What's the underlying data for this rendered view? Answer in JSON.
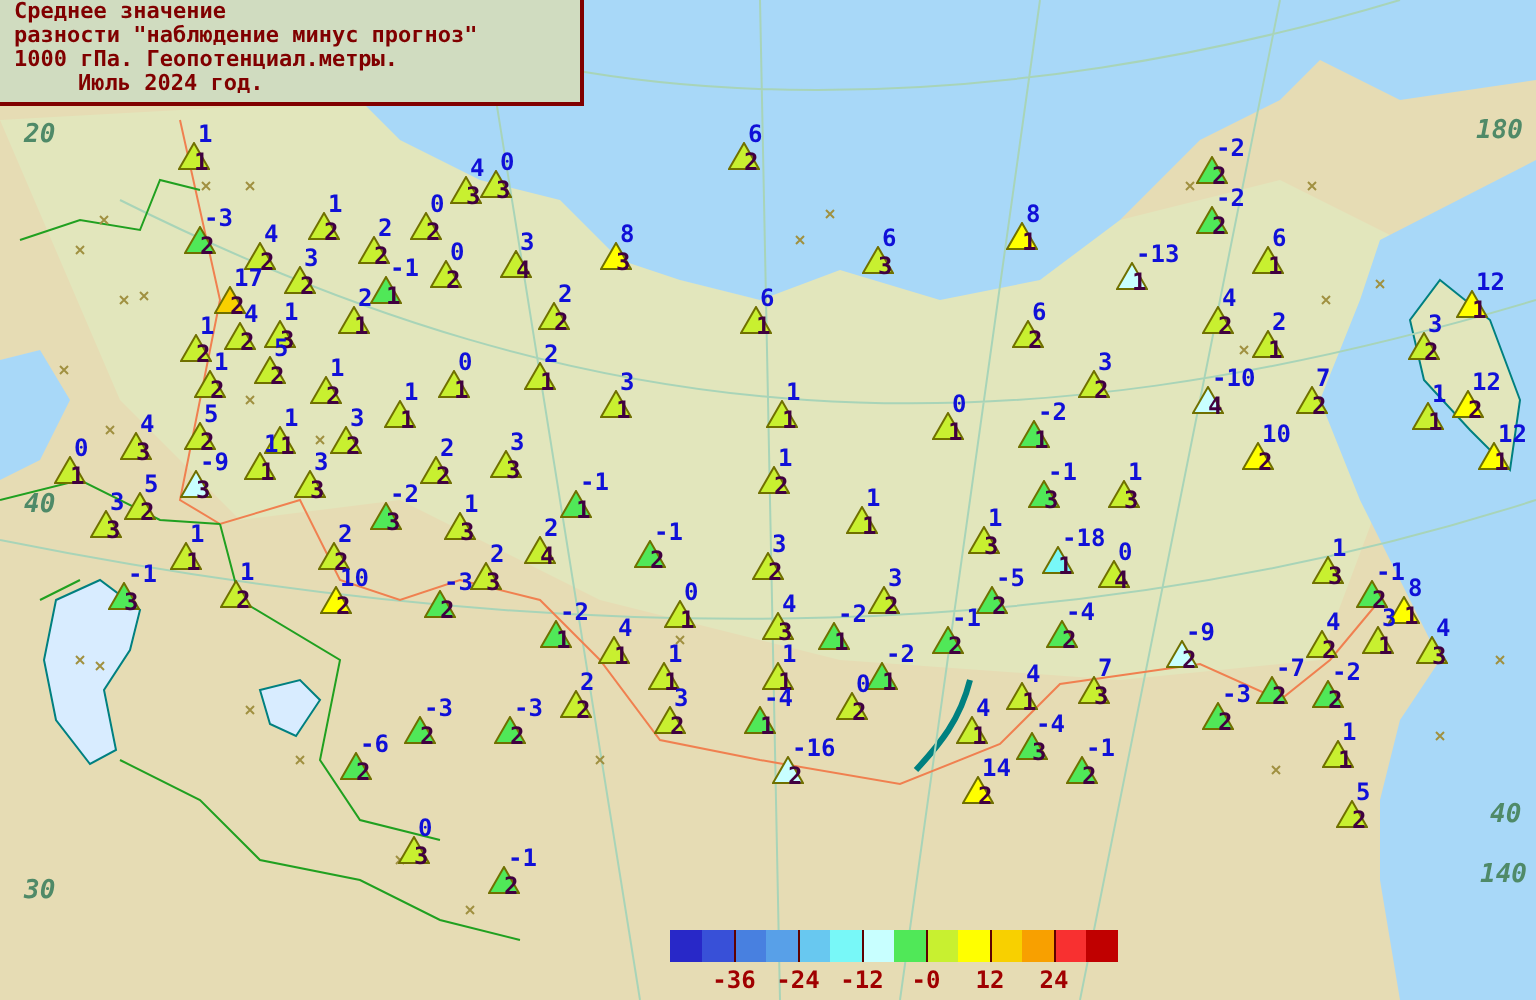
{
  "title": {
    "lines": [
      "Среднее значение",
      "разности \"наблюдение минус прогноз\"",
      "1000 гПа. Геопотенциал.метры."
    ],
    "period": "Июль 2024 год."
  },
  "grid_labels": [
    "20",
    "180",
    "40",
    "40",
    "140",
    "30"
  ],
  "stations": [
    {
      "value": "1",
      "count": "1"
    },
    {
      "value": "6",
      "count": "2"
    },
    {
      "value": "-2",
      "count": "2"
    },
    {
      "value": "4",
      "count": "3"
    },
    {
      "value": "0",
      "count": "3"
    },
    {
      "value": "1",
      "count": "2"
    },
    {
      "value": "0",
      "count": "2"
    },
    {
      "value": "-2",
      "count": "2"
    },
    {
      "value": "-3",
      "count": "2"
    },
    {
      "value": "4",
      "count": "2"
    },
    {
      "value": "2",
      "count": "2"
    },
    {
      "value": "3",
      "count": "4"
    },
    {
      "value": "8",
      "count": "3"
    },
    {
      "value": "6",
      "count": "3"
    },
    {
      "value": "8",
      "count": "1"
    },
    {
      "value": "6",
      "count": "1"
    },
    {
      "value": "3",
      "count": "2"
    },
    {
      "value": "-1",
      "count": "1"
    },
    {
      "value": "0",
      "count": "2"
    },
    {
      "value": "-13",
      "count": "1"
    },
    {
      "value": "17",
      "count": "2"
    },
    {
      "value": "2",
      "count": "1"
    },
    {
      "value": "2",
      "count": "2"
    },
    {
      "value": "6",
      "count": "1"
    },
    {
      "value": "4",
      "count": "2"
    },
    {
      "value": "12",
      "count": "1"
    },
    {
      "value": "1",
      "count": "2"
    },
    {
      "value": "4",
      "count": "2"
    },
    {
      "value": "1",
      "count": "3"
    },
    {
      "value": "6",
      "count": "2"
    },
    {
      "value": "2",
      "count": "1"
    },
    {
      "value": "3",
      "count": "2"
    },
    {
      "value": "1",
      "count": "2"
    },
    {
      "value": "5",
      "count": "2"
    },
    {
      "value": "1",
      "count": "2"
    },
    {
      "value": "0",
      "count": "1"
    },
    {
      "value": "2",
      "count": "1"
    },
    {
      "value": "3",
      "count": "2"
    },
    {
      "value": "1",
      "count": "1"
    },
    {
      "value": "3",
      "count": "1"
    },
    {
      "value": "1",
      "count": "1"
    },
    {
      "value": "0",
      "count": "1"
    },
    {
      "value": "-10",
      "count": "4"
    },
    {
      "value": "7",
      "count": "2"
    },
    {
      "value": "1",
      "count": "1"
    },
    {
      "value": "12",
      "count": "2"
    },
    {
      "value": "4",
      "count": "3"
    },
    {
      "value": "5",
      "count": "2"
    },
    {
      "value": "1",
      "count": "1"
    },
    {
      "value": "3",
      "count": "2"
    },
    {
      "value": "-2",
      "count": "1"
    },
    {
      "value": "10",
      "count": "2"
    },
    {
      "value": "12",
      "count": "1"
    },
    {
      "value": "0",
      "count": "1"
    },
    {
      "value": "-9",
      "count": "3"
    },
    {
      "value": "1",
      "count": "1"
    },
    {
      "value": "3",
      "count": "3"
    },
    {
      "value": "2",
      "count": "2"
    },
    {
      "value": "3",
      "count": "3"
    },
    {
      "value": "1",
      "count": "2"
    },
    {
      "value": "5",
      "count": "2"
    },
    {
      "value": "-2",
      "count": "3"
    },
    {
      "value": "-1",
      "count": "1"
    },
    {
      "value": "1",
      "count": "1"
    },
    {
      "value": "-1",
      "count": "3"
    },
    {
      "value": "1",
      "count": "3"
    },
    {
      "value": "3",
      "count": "3"
    },
    {
      "value": "1",
      "count": "3"
    },
    {
      "value": "2",
      "count": "4"
    },
    {
      "value": "-1",
      "count": "2"
    },
    {
      "value": "1",
      "count": "3"
    },
    {
      "value": "1",
      "count": "1"
    },
    {
      "value": "2",
      "count": "2"
    },
    {
      "value": "2",
      "count": "3"
    },
    {
      "value": "3",
      "count": "2"
    },
    {
      "value": "-18",
      "count": "1"
    },
    {
      "value": "0",
      "count": "4"
    },
    {
      "value": "1",
      "count": "3"
    },
    {
      "value": "-1",
      "count": "3"
    },
    {
      "value": "1",
      "count": "2"
    },
    {
      "value": "10",
      "count": "2"
    },
    {
      "value": "-3",
      "count": "2"
    },
    {
      "value": "0",
      "count": "1"
    },
    {
      "value": "3",
      "count": "2"
    },
    {
      "value": "-5",
      "count": "2"
    },
    {
      "value": "-1",
      "count": "2"
    },
    {
      "value": "8",
      "count": "1"
    },
    {
      "value": "-2",
      "count": "1"
    },
    {
      "value": "4",
      "count": "1"
    },
    {
      "value": "4",
      "count": "3"
    },
    {
      "value": "-2",
      "count": "1"
    },
    {
      "value": "-1",
      "count": "2"
    },
    {
      "value": "-4",
      "count": "2"
    },
    {
      "value": "4",
      "count": "2"
    },
    {
      "value": "3",
      "count": "1"
    },
    {
      "value": "4",
      "count": "3"
    },
    {
      "value": "1",
      "count": "1"
    },
    {
      "value": "1",
      "count": "1"
    },
    {
      "value": "-2",
      "count": "1"
    },
    {
      "value": "-9",
      "count": "2"
    },
    {
      "value": "2",
      "count": "2"
    },
    {
      "value": "0",
      "count": "2"
    },
    {
      "value": "4",
      "count": "1"
    },
    {
      "value": "7",
      "count": "3"
    },
    {
      "value": "-7",
      "count": "2"
    },
    {
      "value": "-2",
      "count": "2"
    },
    {
      "value": "-3",
      "count": "2"
    },
    {
      "value": "-3",
      "count": "2"
    },
    {
      "value": "3",
      "count": "2"
    },
    {
      "value": "-4",
      "count": "1"
    },
    {
      "value": "4",
      "count": "1"
    },
    {
      "value": "-4",
      "count": "3"
    },
    {
      "value": "-3",
      "count": "2"
    },
    {
      "value": "-6",
      "count": "2"
    },
    {
      "value": "-16",
      "count": "2"
    },
    {
      "value": "-1",
      "count": "2"
    },
    {
      "value": "1",
      "count": "1"
    },
    {
      "value": "14",
      "count": "2"
    },
    {
      "value": "5",
      "count": "2"
    },
    {
      "value": "0",
      "count": "3"
    },
    {
      "value": "-1",
      "count": "2"
    }
  ],
  "legend": {
    "swatches": [
      {
        "color": "#2828c8"
      },
      {
        "color": "#3850d8"
      },
      {
        "color": "#4880e0"
      },
      {
        "color": "#58a0e8"
      },
      {
        "color": "#68c8f0"
      },
      {
        "color": "#78f8f8"
      },
      {
        "color": "#c8ffff"
      },
      {
        "color": "#50e858"
      },
      {
        "color": "#c8f030"
      },
      {
        "color": "#ffff00"
      },
      {
        "color": "#f8d000"
      },
      {
        "color": "#f8a000"
      },
      {
        "color": "#f83030"
      },
      {
        "color": "#c00000"
      }
    ],
    "labels": [
      "-36",
      "-24",
      "-12",
      "-0",
      "12",
      "24"
    ]
  }
}
